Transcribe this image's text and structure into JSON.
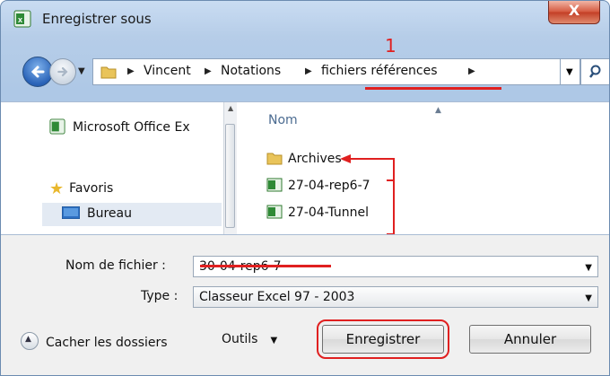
{
  "window": {
    "title": "Enregistrer sous",
    "close_label": "X"
  },
  "address": {
    "crumbs": [
      "Vincent",
      "Notations",
      "fichiers références"
    ],
    "annotation_number": "1"
  },
  "nav_pane": {
    "items": [
      {
        "label": "Microsoft Office Ex",
        "icon": "excel-icon"
      },
      {
        "label": "Favoris",
        "icon": "star-icon"
      },
      {
        "label": "Bureau",
        "icon": "desktop-icon",
        "selected": true
      }
    ]
  },
  "file_list": {
    "column_header": "Nom",
    "items": [
      {
        "name": "Archives",
        "icon": "folder-icon"
      },
      {
        "name": "27-04-rep6-7",
        "icon": "excel-file-icon"
      },
      {
        "name": "27-04-Tunnel",
        "icon": "excel-file-icon"
      }
    ]
  },
  "form": {
    "filename_label": "Nom de fichier :",
    "filename_value": "30-04-rep6-7",
    "type_label": "Type :",
    "type_value": "Classeur Excel 97 - 2003"
  },
  "footer": {
    "hide_folders_label": "Cacher les dossiers",
    "tools_label": "Outils",
    "save_label": "Enregistrer",
    "cancel_label": "Annuler"
  },
  "colors": {
    "annotation": "#e02020",
    "title_bar": "#c9dcf2",
    "footer_bg": "#f0f0f0"
  }
}
